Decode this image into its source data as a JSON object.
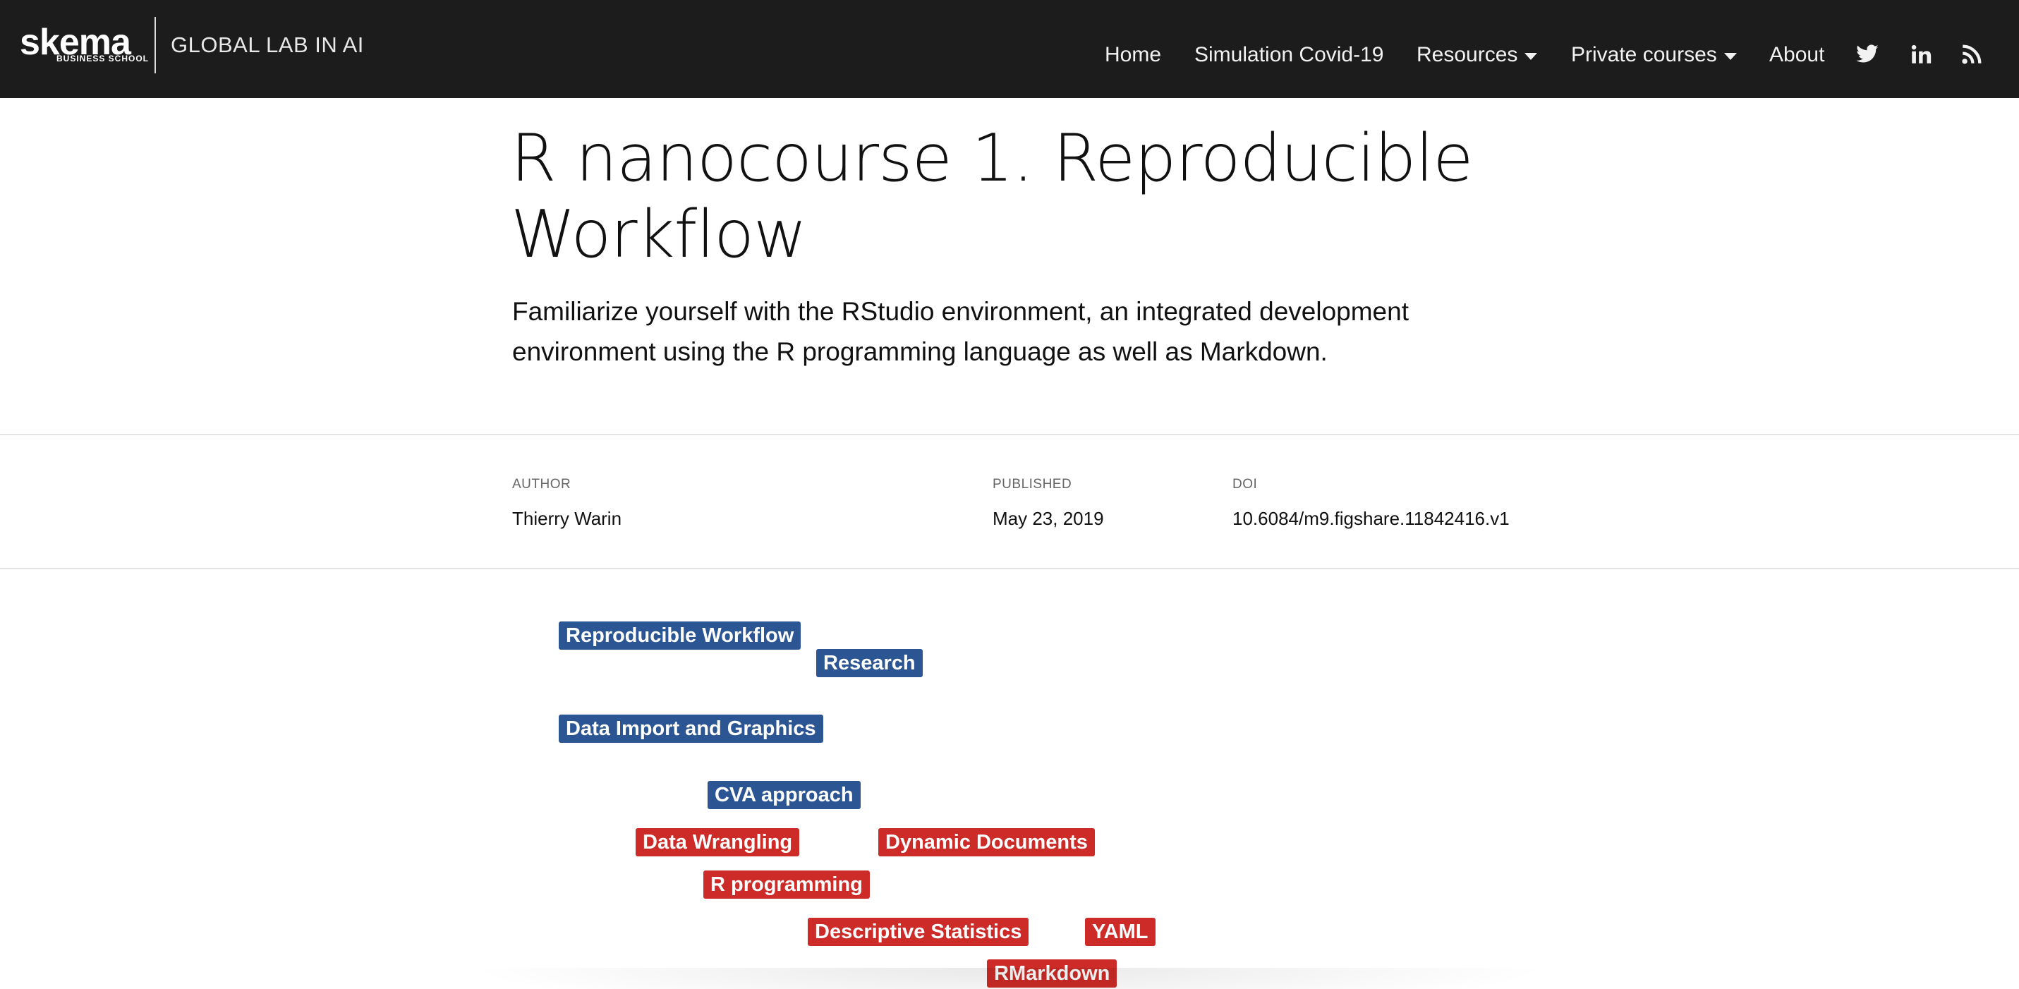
{
  "header": {
    "logo_word": "skema",
    "logo_sub": "BUSINESS SCHOOL",
    "lab_title": "GLOBAL LAB IN AI",
    "nav": [
      {
        "label": "Home"
      },
      {
        "label": "Simulation Covid-19"
      },
      {
        "label": "Resources",
        "dropdown": true
      },
      {
        "label": "Private courses",
        "dropdown": true
      },
      {
        "label": "About"
      }
    ],
    "social_icons": [
      "twitter-icon",
      "linkedin-icon",
      "rss-icon"
    ],
    "background": "#1c1c1c"
  },
  "article": {
    "title_line1": "R nanocourse 1. Reproducible",
    "title_line2": "Workflow",
    "subtitle_line1": "Familiarize yourself with the RStudio environment, an integrated development",
    "subtitle_line2": "environment using the R programming language as well as Markdown."
  },
  "meta": {
    "author_label": "AUTHOR",
    "author": "Thierry Warin",
    "published_label": "PUBLISHED",
    "published": "May 23, 2019",
    "doi_label": "DOI",
    "doi": "10.6084/m9.figshare.11842416.v1"
  },
  "tags": [
    {
      "label": "Reproducible Workflow",
      "color": "#2c5593"
    },
    {
      "label": "Research",
      "color": "#2c5593"
    },
    {
      "label": "Data Import and Graphics",
      "color": "#2c5593"
    },
    {
      "label": "CVA approach",
      "color": "#2c5593"
    },
    {
      "label": "Data Wrangling",
      "color": "#cc2b27"
    },
    {
      "label": "Dynamic Documents",
      "color": "#cc2b27"
    },
    {
      "label": "R programming",
      "color": "#cc2b27"
    },
    {
      "label": "Descriptive Statistics",
      "color": "#cc2b27"
    },
    {
      "label": "YAML",
      "color": "#cc2b27"
    },
    {
      "label": "RMarkdown",
      "color": "#cc2b27"
    }
  ]
}
